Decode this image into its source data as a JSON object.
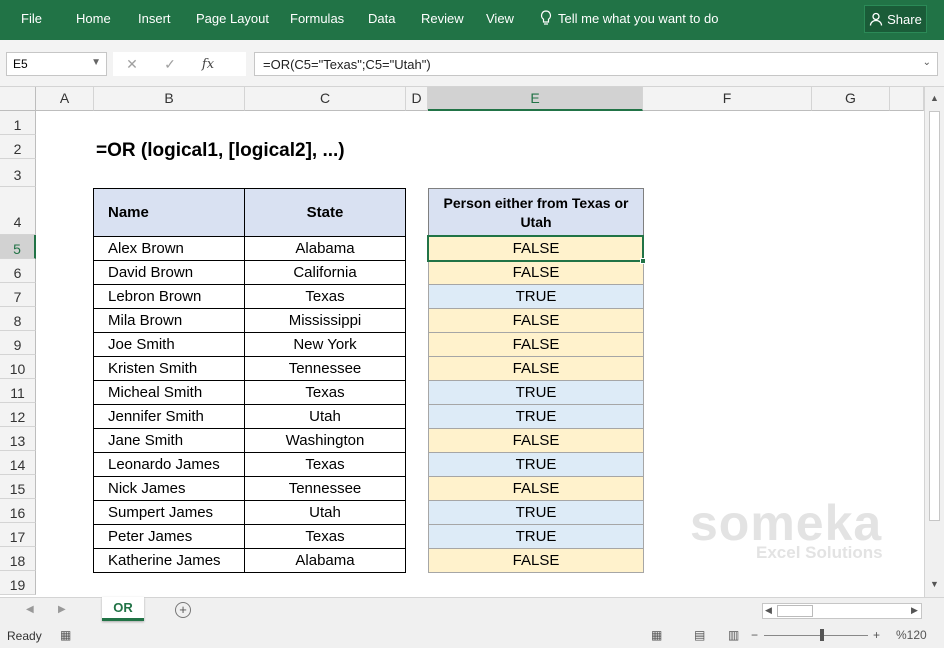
{
  "ribbon": {
    "tabs": [
      "File",
      "Home",
      "Insert",
      "Page Layout",
      "Formulas",
      "Data",
      "Review",
      "View"
    ],
    "tell_me": "Tell me what you want to do",
    "share": "Share",
    "bg_color": "#217346"
  },
  "formula_bar": {
    "name_box": "E5",
    "cancel_icon": "✕",
    "enter_icon": "✓",
    "fx_label": "fx",
    "formula": "=OR(C5=\"Texas\";C5=\"Utah\")"
  },
  "columns": [
    "A",
    "B",
    "C",
    "D",
    "E",
    "F",
    "G"
  ],
  "rows": [
    "1",
    "2",
    "3",
    "4",
    "5",
    "6",
    "7",
    "8",
    "9",
    "10",
    "11",
    "12",
    "13",
    "14",
    "15",
    "16",
    "17",
    "18",
    "19"
  ],
  "title": "=OR (logical1, [logical2], ...)",
  "table": {
    "headers": {
      "name": "Name",
      "state": "State"
    },
    "rows": [
      {
        "name": "Alex Brown",
        "state": "Alabama"
      },
      {
        "name": "David Brown",
        "state": "California"
      },
      {
        "name": "Lebron Brown",
        "state": "Texas"
      },
      {
        "name": "Mila Brown",
        "state": "Mississippi"
      },
      {
        "name": "Joe Smith",
        "state": "New York"
      },
      {
        "name": "Kristen Smith",
        "state": "Tennessee"
      },
      {
        "name": "Micheal Smith",
        "state": "Texas"
      },
      {
        "name": "Jennifer Smith",
        "state": "Utah"
      },
      {
        "name": "Jane Smith",
        "state": "Washington"
      },
      {
        "name": "Leonardo James",
        "state": "Texas"
      },
      {
        "name": "Nick James",
        "state": "Tennessee"
      },
      {
        "name": "Sumpert James",
        "state": "Utah"
      },
      {
        "name": "Peter James",
        "state": "Texas"
      },
      {
        "name": "Katherine James",
        "state": "Alabama"
      }
    ]
  },
  "result": {
    "header_line1": "Person either from Texas or",
    "header_line2": "Utah",
    "values": [
      "FALSE",
      "FALSE",
      "TRUE",
      "FALSE",
      "FALSE",
      "FALSE",
      "TRUE",
      "TRUE",
      "FALSE",
      "TRUE",
      "FALSE",
      "TRUE",
      "TRUE",
      "FALSE"
    ],
    "false_color": "#fff2cc",
    "true_color": "#ddebf7"
  },
  "watermark": {
    "brand": "someka",
    "tagline": "Excel Solutions"
  },
  "sheet_tab": "OR",
  "status": {
    "ready": "Ready",
    "zoom": "%120"
  }
}
